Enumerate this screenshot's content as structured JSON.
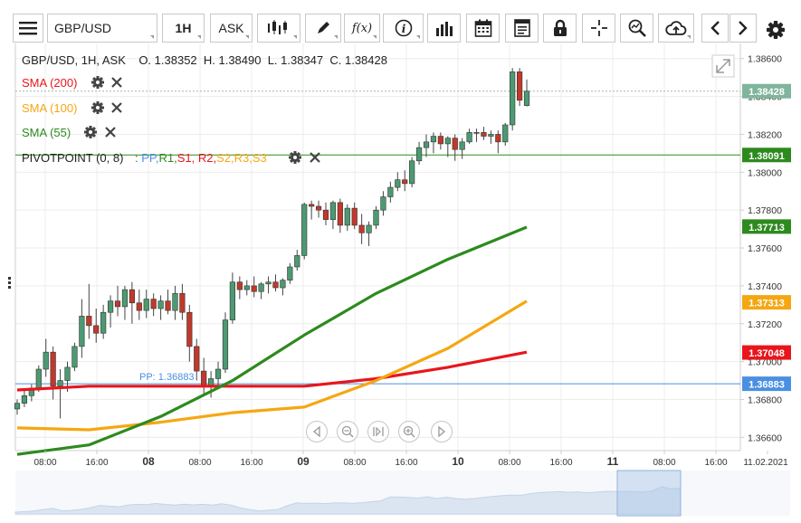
{
  "toolbar": {
    "symbol": "GBP/USD",
    "timeframe": "1H",
    "price_type": "ASK",
    "fx_label": "f(x)",
    "info_label": "i"
  },
  "legend": {
    "ohlc_line": "GBP/USD, 1H, ASK    O. 1.38352  H. 1.38490  L. 1.38347  C. 1.38428",
    "sma200": "SMA (200)",
    "sma100": "SMA (100)",
    "sma55": "SMA (55)",
    "pivot_title": "PIVOTPOINT (0, 8)",
    "pivot_items": [
      ":",
      "PP,",
      "R1,",
      "S1,",
      "R2,",
      "S2,",
      "R3,",
      "S3"
    ]
  },
  "colors": {
    "up": "#4c9a72",
    "down": "#c0392b",
    "sma200": "#e8161c",
    "sma100": "#f5a712",
    "sma55": "#2d8a1e",
    "pp": "#4a90e2",
    "r1": "#2d8a1e",
    "s1": "#e8161c",
    "r2": "#e8161c",
    "s2": "#f5a712",
    "r3": "#f5a712",
    "s3": "#f5a712"
  },
  "chart_data": {
    "type": "candlestick",
    "symbol": "GBP/USD",
    "timeframe": "1H",
    "ohlc_last": {
      "open": 1.38352,
      "high": 1.3849,
      "low": 1.38347,
      "close": 1.38428
    },
    "ylim": [
      1.3653,
      1.3868
    ],
    "y_ticks": [
      1.366,
      1.368,
      1.37,
      1.372,
      1.374,
      1.376,
      1.378,
      1.38,
      1.382,
      1.384,
      1.386
    ],
    "y_tick_labels": [
      "1.36600",
      "1.36800",
      "1.37000",
      "1.37200",
      "1.37400",
      "1.37600",
      "1.37800",
      "1.38000",
      "1.38200",
      "1.38400",
      "1.38600"
    ],
    "x_labels": [
      {
        "label": "08:00",
        "day": false
      },
      {
        "label": "16:00",
        "day": false
      },
      {
        "label": "08",
        "day": true
      },
      {
        "label": "08:00",
        "day": false
      },
      {
        "label": "16:00",
        "day": false
      },
      {
        "label": "09",
        "day": true
      },
      {
        "label": "08:00",
        "day": false
      },
      {
        "label": "16:00",
        "day": false
      },
      {
        "label": "10",
        "day": true
      },
      {
        "label": "08:00",
        "day": false
      },
      {
        "label": "16:00",
        "day": false
      },
      {
        "label": "11",
        "day": true
      },
      {
        "label": "08:00",
        "day": false
      },
      {
        "label": "16:00",
        "day": false
      },
      {
        "label": "11.02.2021",
        "day": false
      }
    ],
    "candles": [
      [
        1.3675,
        1.368,
        1.3672,
        1.3678
      ],
      [
        1.3678,
        1.3685,
        1.3676,
        1.3682
      ],
      [
        1.3682,
        1.3688,
        1.3679,
        1.3686
      ],
      [
        1.3686,
        1.3698,
        1.3684,
        1.3696
      ],
      [
        1.3696,
        1.3712,
        1.3692,
        1.3705
      ],
      [
        1.3705,
        1.3708,
        1.368,
        1.3687
      ],
      [
        1.3687,
        1.3696,
        1.367,
        1.369
      ],
      [
        1.369,
        1.37,
        1.3684,
        1.3697
      ],
      [
        1.3697,
        1.371,
        1.3695,
        1.3708
      ],
      [
        1.3708,
        1.3733,
        1.3702,
        1.3724
      ],
      [
        1.3724,
        1.3741,
        1.3712,
        1.3719
      ],
      [
        1.3719,
        1.3728,
        1.371,
        1.3715
      ],
      [
        1.3715,
        1.373,
        1.3712,
        1.3726
      ],
      [
        1.3726,
        1.3735,
        1.3718,
        1.3732
      ],
      [
        1.3732,
        1.374,
        1.3724,
        1.3729
      ],
      [
        1.3729,
        1.374,
        1.3722,
        1.3738
      ],
      [
        1.3738,
        1.3742,
        1.372,
        1.3731
      ],
      [
        1.3731,
        1.3738,
        1.3722,
        1.3727
      ],
      [
        1.3727,
        1.3738,
        1.3723,
        1.3733
      ],
      [
        1.3733,
        1.3736,
        1.3724,
        1.3728
      ],
      [
        1.3728,
        1.3735,
        1.3722,
        1.3732
      ],
      [
        1.3732,
        1.3738,
        1.3725,
        1.3727
      ],
      [
        1.3727,
        1.374,
        1.3722,
        1.3736
      ],
      [
        1.3736,
        1.3741,
        1.3722,
        1.3726
      ],
      [
        1.3726,
        1.373,
        1.37,
        1.3708
      ],
      [
        1.3708,
        1.3712,
        1.369,
        1.3695
      ],
      [
        1.3695,
        1.3702,
        1.3683,
        1.3687
      ],
      [
        1.3687,
        1.3695,
        1.3681,
        1.3691
      ],
      [
        1.3691,
        1.37,
        1.3686,
        1.3696
      ],
      [
        1.3696,
        1.3726,
        1.3694,
        1.3722
      ],
      [
        1.3722,
        1.3747,
        1.372,
        1.3742
      ],
      [
        1.3742,
        1.3745,
        1.3733,
        1.3738
      ],
      [
        1.3738,
        1.3743,
        1.3735,
        1.374
      ],
      [
        1.374,
        1.3745,
        1.3734,
        1.3737
      ],
      [
        1.3737,
        1.3742,
        1.3733,
        1.3741
      ],
      [
        1.3741,
        1.3745,
        1.3736,
        1.3742
      ],
      [
        1.3742,
        1.3746,
        1.3737,
        1.3739
      ],
      [
        1.3739,
        1.3744,
        1.3735,
        1.3743
      ],
      [
        1.3743,
        1.3752,
        1.3741,
        1.375
      ],
      [
        1.375,
        1.3759,
        1.3748,
        1.3756
      ],
      [
        1.3756,
        1.3784,
        1.3754,
        1.3783
      ],
      [
        1.3783,
        1.3785,
        1.3775,
        1.3782
      ],
      [
        1.3782,
        1.3785,
        1.3776,
        1.378
      ],
      [
        1.378,
        1.3784,
        1.3772,
        1.3775
      ],
      [
        1.3775,
        1.3785,
        1.377,
        1.3784
      ],
      [
        1.3784,
        1.3786,
        1.3768,
        1.3772
      ],
      [
        1.3772,
        1.3783,
        1.3769,
        1.3781
      ],
      [
        1.3781,
        1.3784,
        1.377,
        1.3772
      ],
      [
        1.3772,
        1.3778,
        1.3762,
        1.3768
      ],
      [
        1.3768,
        1.3774,
        1.3761,
        1.3772
      ],
      [
        1.3772,
        1.3782,
        1.377,
        1.378
      ],
      [
        1.378,
        1.379,
        1.3777,
        1.3787
      ],
      [
        1.3787,
        1.3795,
        1.3784,
        1.3792
      ],
      [
        1.3792,
        1.38,
        1.379,
        1.3796
      ],
      [
        1.3796,
        1.3801,
        1.379,
        1.3794
      ],
      [
        1.3794,
        1.3808,
        1.3792,
        1.3806
      ],
      [
        1.3806,
        1.3816,
        1.3804,
        1.3813
      ],
      [
        1.3813,
        1.382,
        1.3808,
        1.3816
      ],
      [
        1.3816,
        1.3821,
        1.381,
        1.3819
      ],
      [
        1.3819,
        1.3821,
        1.3812,
        1.3815
      ],
      [
        1.3815,
        1.3819,
        1.3808,
        1.3818
      ],
      [
        1.3818,
        1.382,
        1.3806,
        1.3812
      ],
      [
        1.3812,
        1.3818,
        1.3807,
        1.3816
      ],
      [
        1.3816,
        1.3823,
        1.3815,
        1.3821
      ],
      [
        1.3821,
        1.3823,
        1.3816,
        1.3821
      ],
      [
        1.3821,
        1.3824,
        1.3817,
        1.3819
      ],
      [
        1.3819,
        1.3822,
        1.3815,
        1.382
      ],
      [
        1.382,
        1.3822,
        1.381,
        1.3816
      ],
      [
        1.3816,
        1.3826,
        1.3814,
        1.3825
      ],
      [
        1.3825,
        1.3855,
        1.3822,
        1.3853
      ],
      [
        1.3853,
        1.3855,
        1.3835,
        1.3838
      ],
      [
        1.38352,
        1.3849,
        1.38347,
        1.38428
      ]
    ],
    "series": [
      {
        "name": "SMA (200)",
        "color": "#e8161c",
        "x": [
          0,
          10,
          20,
          40,
          50,
          60,
          71
        ],
        "y": [
          1.3685,
          1.3687,
          1.3687,
          1.3687,
          1.3691,
          1.3697,
          1.3705
        ]
      },
      {
        "name": "SMA (100)",
        "color": "#f5a712",
        "x": [
          0,
          10,
          20,
          30,
          40,
          50,
          60,
          71
        ],
        "y": [
          1.3665,
          1.3664,
          1.3668,
          1.3673,
          1.3676,
          1.369,
          1.3707,
          1.3732
        ]
      },
      {
        "name": "SMA (55)",
        "color": "#2d8a1e",
        "x": [
          0,
          10,
          20,
          30,
          40,
          50,
          60,
          71
        ],
        "y": [
          1.3651,
          1.3656,
          1.3671,
          1.369,
          1.3714,
          1.3736,
          1.3754,
          1.3771
        ]
      }
    ],
    "levels": [
      {
        "name": "PP",
        "value": 1.36883,
        "label": "PP: 1.36883",
        "tag": "1.36883",
        "color": "#4a90e2"
      },
      {
        "name": "R1",
        "value": 1.38091,
        "label": "",
        "tag": "1.38091",
        "color": "#2d8a1e"
      }
    ],
    "price_tags": [
      {
        "value": 1.38428,
        "text": "1.38428",
        "color": "#7fb59c"
      },
      {
        "value": 1.37713,
        "text": "1.37713",
        "color": "#2d8a1e"
      },
      {
        "value": 1.37313,
        "text": "1.37313",
        "color": "#f5a712"
      },
      {
        "value": 1.37048,
        "text": "1.37048",
        "color": "#e8161c"
      }
    ]
  }
}
